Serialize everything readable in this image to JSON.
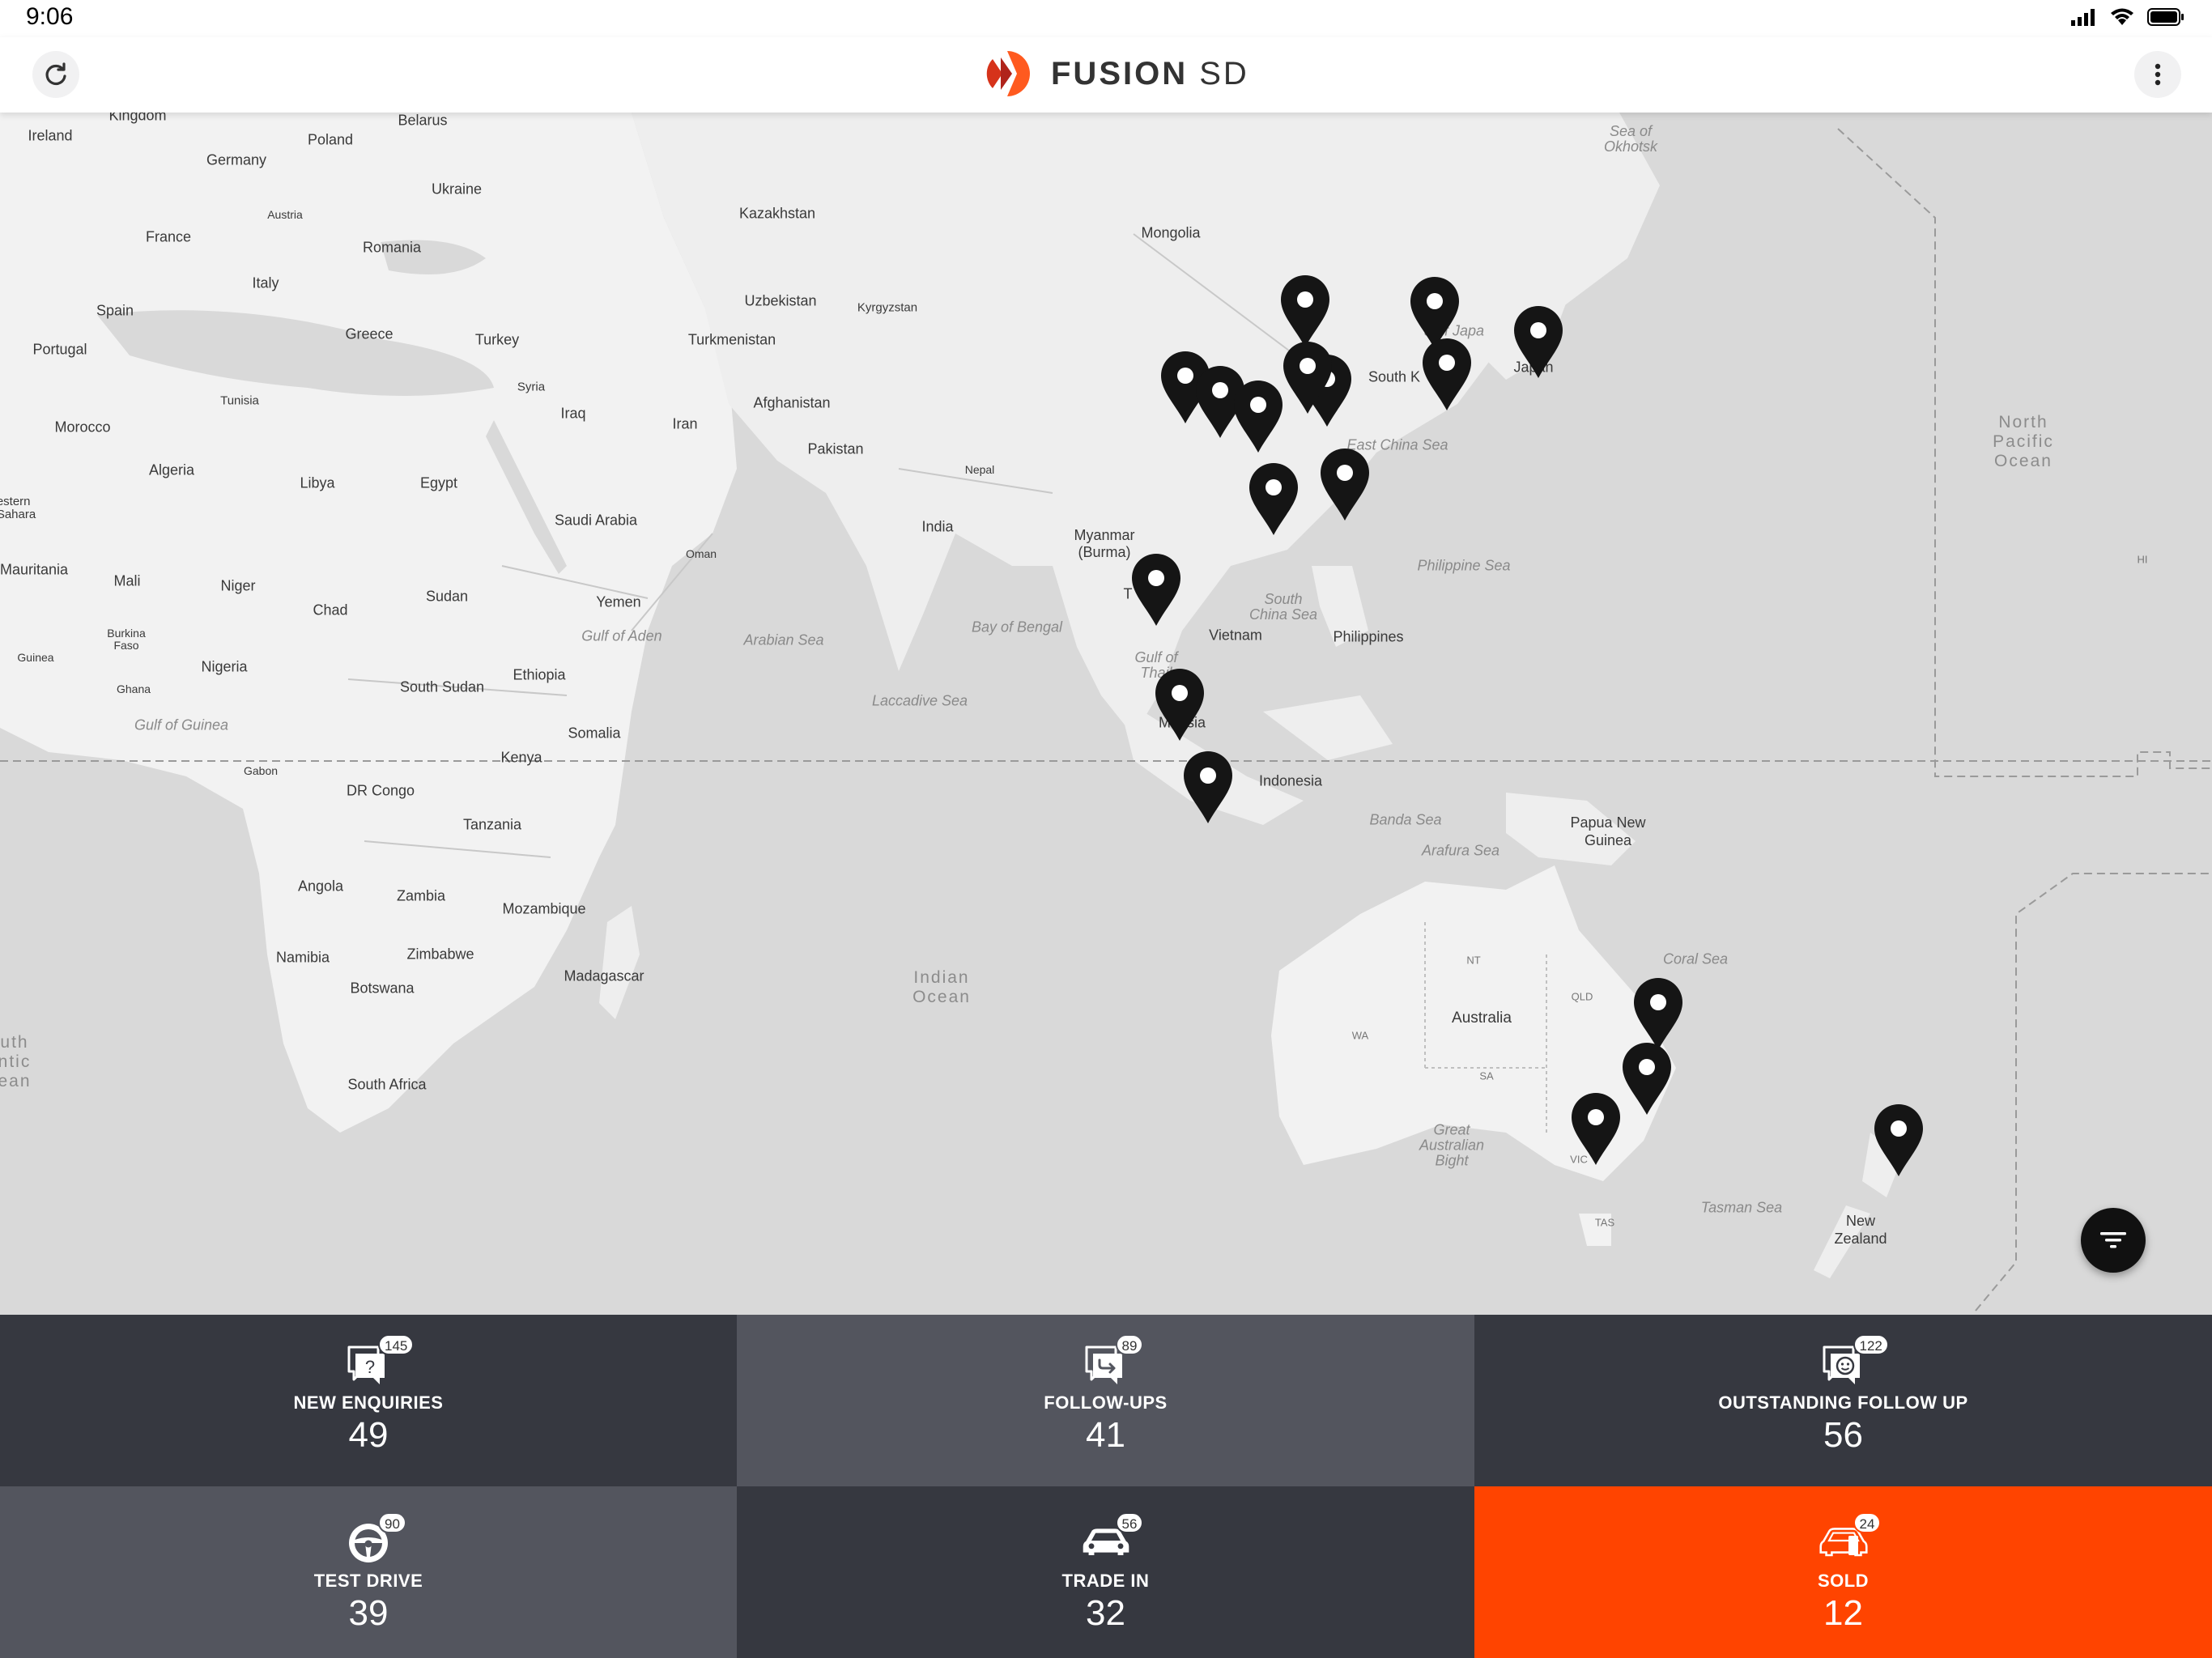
{
  "status_bar": {
    "time": "9:06",
    "icons": [
      "signal-icon",
      "wifi-icon",
      "battery-icon"
    ]
  },
  "header": {
    "logo_word": "FUSION",
    "logo_suffix": "SD",
    "brand_color": "#ff4400",
    "left_action": "refresh-icon",
    "right_action": "more-vertical-icon"
  },
  "map": {
    "labels": {
      "kingdom": "Kingdom",
      "ireland": "Ireland",
      "belarus": "Belarus",
      "poland": "Poland",
      "germany": "Germany",
      "ukraine": "Ukraine",
      "austria": "Austria",
      "france": "France",
      "romania": "Romania",
      "italy": "Italy",
      "spain": "Spain",
      "portugal": "Portugal",
      "greece": "Greece",
      "turkey": "Turkey",
      "syria": "Syria",
      "iraq": "Iraq",
      "iran": "Iran",
      "tunisia": "Tunisia",
      "morocco": "Morocco",
      "algeria": "Algeria",
      "libya": "Libya",
      "egypt": "Egypt",
      "w_sahara": "estern\nSahara",
      "mauritania": "Mauritania",
      "mali": "Mali",
      "niger": "Niger",
      "chad": "Chad",
      "sudan": "Sudan",
      "saudi": "Saudi Arabia",
      "oman": "Oman",
      "yemen": "Yemen",
      "gulf_aden": "Gulf of Aden",
      "ethiopia": "Ethiopia",
      "guinea": "Guinea",
      "burkina": "Burkina\nFaso",
      "nigeria": "Nigeria",
      "ghana": "Ghana",
      "south_sudan": "South Sudan",
      "somalia": "Somalia",
      "gulf_guinea": "Gulf of Guinea",
      "gabon": "Gabon",
      "kenya": "Kenya",
      "dr_congo": "DR Congo",
      "tanzania": "Tanzania",
      "angola": "Angola",
      "zambia": "Zambia",
      "mozambique": "Mozambique",
      "namibia": "Namibia",
      "zimbabwe": "Zimbabwe",
      "botswana": "Botswana",
      "madagascar": "Madagascar",
      "south_africa": "South Africa",
      "atlantic": "uth\nntic\nean",
      "kazakhstan": "Kazakhstan",
      "uzbekistan": "Uzbekistan",
      "kyrgyzstan": "Kyrgyzstan",
      "turkmenistan": "Turkmenistan",
      "afghanistan": "Afghanistan",
      "pakistan": "Pakistan",
      "nepal": "Nepal",
      "india": "India",
      "mongolia": "Mongolia",
      "china": "ina",
      "south_korea": "South K",
      "sea_japan": "a of Japa",
      "japan": "Japan",
      "east_china_sea": "East China Sea",
      "sea_okhotsk": "Sea of\nOkhotsk",
      "myanmar": "Myanmar\n(Burma)",
      "thailand": "T",
      "vietnam": "Vietnam",
      "south_china_sea": "South\nChina Sea",
      "philippines": "Philippines",
      "philippine_sea": "Philippine Sea",
      "gulf_thailand": "Gulf of\nThail",
      "malaysia": "M    sia",
      "indonesia": "Indonesia",
      "banda_sea": "Banda Sea",
      "arafura_sea": "Arafura Sea",
      "png": "Papua New\nGuinea",
      "arabian_sea": "Arabian Sea",
      "bay_bengal": "Bay of Bengal",
      "laccadive": "Laccadive Sea",
      "indian_ocean": "Indian\nOcean",
      "north_pacific": "North\nPacific\nOcean",
      "hi": "HI",
      "coral_sea": "Coral Sea",
      "nt": "NT",
      "qld": "QLD",
      "wa": "WA",
      "sa": "SA",
      "australia": "Australia",
      "great_bight": "Great\nAustralian\nBight",
      "vic": "VIC",
      "tas": "TAS",
      "tasman_sea": "Tasman Sea",
      "new_zealand": "New\nZealand"
    },
    "pins": [
      "pin-1",
      "pin-2",
      "pin-3",
      "pin-4",
      "pin-5",
      "pin-6",
      "pin-7",
      "pin-8",
      "pin-9",
      "pin-10",
      "pin-11",
      "pin-12",
      "pin-13",
      "pin-14",
      "pin-15",
      "pin-16",
      "pin-17",
      "pin-18"
    ],
    "filter_icon": "filter-icon"
  },
  "tiles": [
    {
      "label": "NEW ENQUIRIES",
      "value": "49",
      "badge": "145",
      "icon": "question-chat-icon"
    },
    {
      "label": "FOLLOW-UPS",
      "value": "41",
      "badge": "89",
      "icon": "reply-chat-icon"
    },
    {
      "label": "OUTSTANDING FOLLOW UP",
      "value": "56",
      "badge": "122",
      "icon": "smiley-chat-icon"
    },
    {
      "label": "TEST DRIVE",
      "value": "39",
      "badge": "90",
      "icon": "steering-wheel-icon"
    },
    {
      "label": "TRADE IN",
      "value": "32",
      "badge": "56",
      "icon": "car-icon"
    },
    {
      "label": "SOLD",
      "value": "12",
      "badge": "24",
      "icon": "sold-car-icon"
    }
  ],
  "colors": {
    "accent": "#ff4400",
    "tile_dark": "#363840",
    "tile_mid": "#53555e"
  }
}
